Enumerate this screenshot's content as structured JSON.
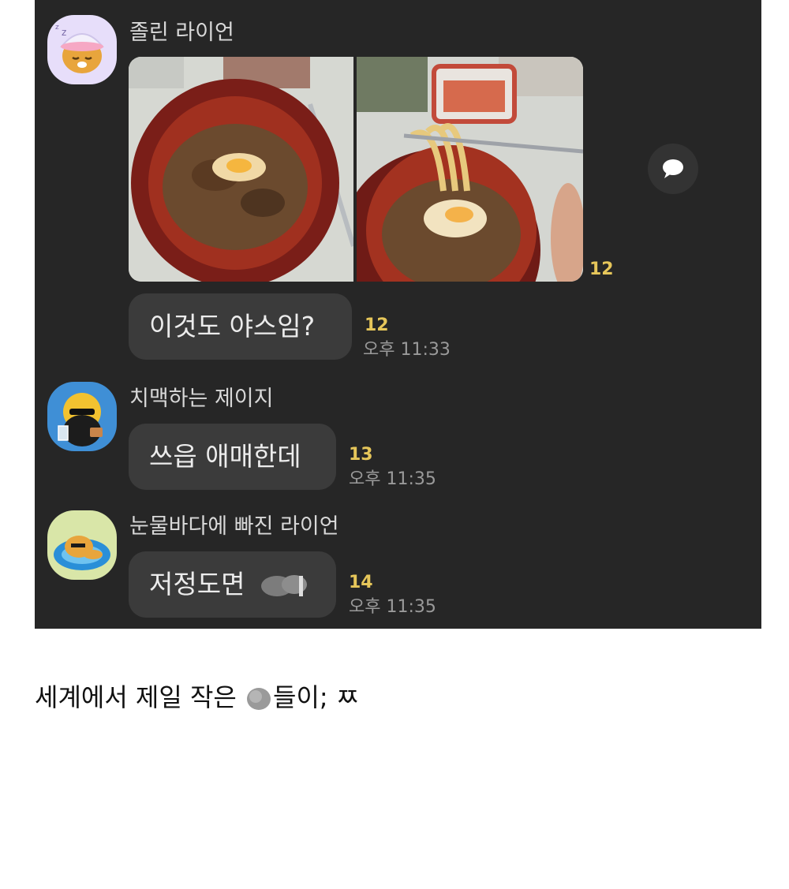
{
  "messages": [
    {
      "sender": "졸린 라이언",
      "avatar_icon": "sleepy-ryan-avatar",
      "photo_count": "12",
      "text": "이것도 야스임?",
      "count": "12",
      "time": "오후 11:33"
    },
    {
      "sender": "치맥하는 제이지",
      "avatar_icon": "chimaek-jay-g-avatar",
      "text": "쓰읍 애매한데",
      "count": "13",
      "time": "오후 11:35"
    },
    {
      "sender": "눈물바다에 빠진 라이언",
      "avatar_icon": "crying-ryan-avatar",
      "text_visible": "저정도면",
      "count": "14",
      "time": "오후 11:35"
    }
  ],
  "share_icon": "speech-bubble-icon",
  "caption": {
    "before": "세계에서 제일 작은",
    "after": "들이; ㅉ"
  },
  "colors": {
    "chat_background": "#262626",
    "bubble": "#3b3b3b",
    "unread_count": "#e6c65a"
  }
}
